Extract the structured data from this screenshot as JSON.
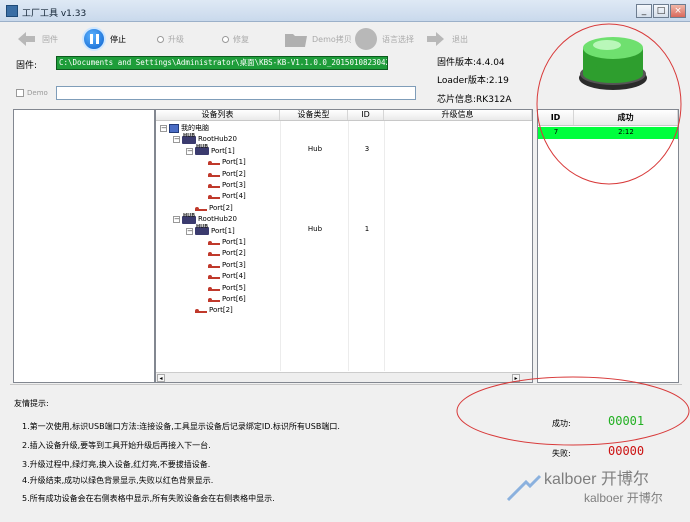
{
  "window": {
    "title": "工厂工具 v1.33"
  },
  "toolbar": {
    "firmware_label": "固件",
    "stop_label": "停止",
    "upgrade_label": "升级",
    "repair_label": "修复",
    "demo_copy_label": "Demo拷贝",
    "language_label": "语言选择",
    "exit_label": "退出",
    "upgrade_selected": true,
    "repair_selected": false
  },
  "firmware": {
    "label": "固件:",
    "path": "C:\\Documents and Settings\\Administrator\\桌面\\KBS-KB-V1.1.0.0_20150108230428.img"
  },
  "demo": {
    "label": "Demo",
    "checked": false,
    "path": ""
  },
  "info": {
    "fw_version": "固件版本:4.4.04",
    "loader_version": "Loader版本:2.19",
    "chip_info": "芯片信息:RK312A"
  },
  "status_light": {
    "color": "#3cc43c",
    "state": "green"
  },
  "device_table": {
    "columns": [
      "设备列表",
      "设备类型",
      "ID",
      "升级信息"
    ],
    "rows": [
      {
        "level": 0,
        "icon": "pc",
        "expander": "−",
        "name": "我的电脑",
        "type": "",
        "id": ""
      },
      {
        "level": 1,
        "icon": "hub",
        "expander": "−",
        "name": "RootHub20",
        "type": "",
        "id": ""
      },
      {
        "level": 2,
        "icon": "hub",
        "expander": "−",
        "name": "Port[1]",
        "type": "Hub",
        "id": "3"
      },
      {
        "level": 3,
        "icon": "usb",
        "expander": "",
        "name": "Port[1]",
        "type": "",
        "id": ""
      },
      {
        "level": 3,
        "icon": "usb",
        "expander": "",
        "name": "Port[2]",
        "type": "",
        "id": ""
      },
      {
        "level": 3,
        "icon": "usb",
        "expander": "",
        "name": "Port[3]",
        "type": "",
        "id": ""
      },
      {
        "level": 3,
        "icon": "usb",
        "expander": "",
        "name": "Port[4]",
        "type": "",
        "id": ""
      },
      {
        "level": 2,
        "icon": "usb",
        "expander": "",
        "name": "Port[2]",
        "type": "",
        "id": ""
      },
      {
        "level": 1,
        "icon": "hub",
        "expander": "−",
        "name": "RootHub20",
        "type": "",
        "id": ""
      },
      {
        "level": 2,
        "icon": "hub",
        "expander": "−",
        "name": "Port[1]",
        "type": "Hub",
        "id": "1"
      },
      {
        "level": 3,
        "icon": "usb",
        "expander": "",
        "name": "Port[1]",
        "type": "",
        "id": ""
      },
      {
        "level": 3,
        "icon": "usb",
        "expander": "",
        "name": "Port[2]",
        "type": "",
        "id": ""
      },
      {
        "level": 3,
        "icon": "usb",
        "expander": "",
        "name": "Port[3]",
        "type": "",
        "id": ""
      },
      {
        "level": 3,
        "icon": "usb",
        "expander": "",
        "name": "Port[4]",
        "type": "",
        "id": ""
      },
      {
        "level": 3,
        "icon": "usb",
        "expander": "",
        "name": "Port[5]",
        "type": "",
        "id": ""
      },
      {
        "level": 3,
        "icon": "usb",
        "expander": "",
        "name": "Port[6]",
        "type": "",
        "id": ""
      },
      {
        "level": 2,
        "icon": "usb",
        "expander": "",
        "name": "Port[2]",
        "type": "",
        "id": ""
      }
    ]
  },
  "result_table": {
    "columns": [
      "ID",
      "成功"
    ],
    "rows": [
      {
        "id": "7",
        "value": "2:12",
        "color": "#00ff3c"
      }
    ]
  },
  "hints": {
    "title": "友情提示:",
    "items": [
      "1.第一次使用,标识USB端口方法:连接设备,工具显示设备后记录绑定ID.标识所有USB端口.",
      "2.插入设备升级,要等到工具开始升级后再接入下一台.",
      "3.升级过程中,绿灯亮,换入设备,红灯亮,不要拔插设备.",
      "4.升级结束,成功以绿色背景显示,失败以红色背景显示.",
      "5.所有成功设备会在右侧表格中显示,所有失败设备会在右侧表格中显示."
    ]
  },
  "counters": {
    "success_label": "成功:",
    "success_value": "00001",
    "fail_label": "失败:",
    "fail_value": "00000",
    "success_color": "#22b022",
    "fail_color": "#cc1111"
  },
  "watermark": {
    "text": "kalboer 开博尔"
  },
  "colors": {
    "annotation_red": "#d83a3a"
  }
}
